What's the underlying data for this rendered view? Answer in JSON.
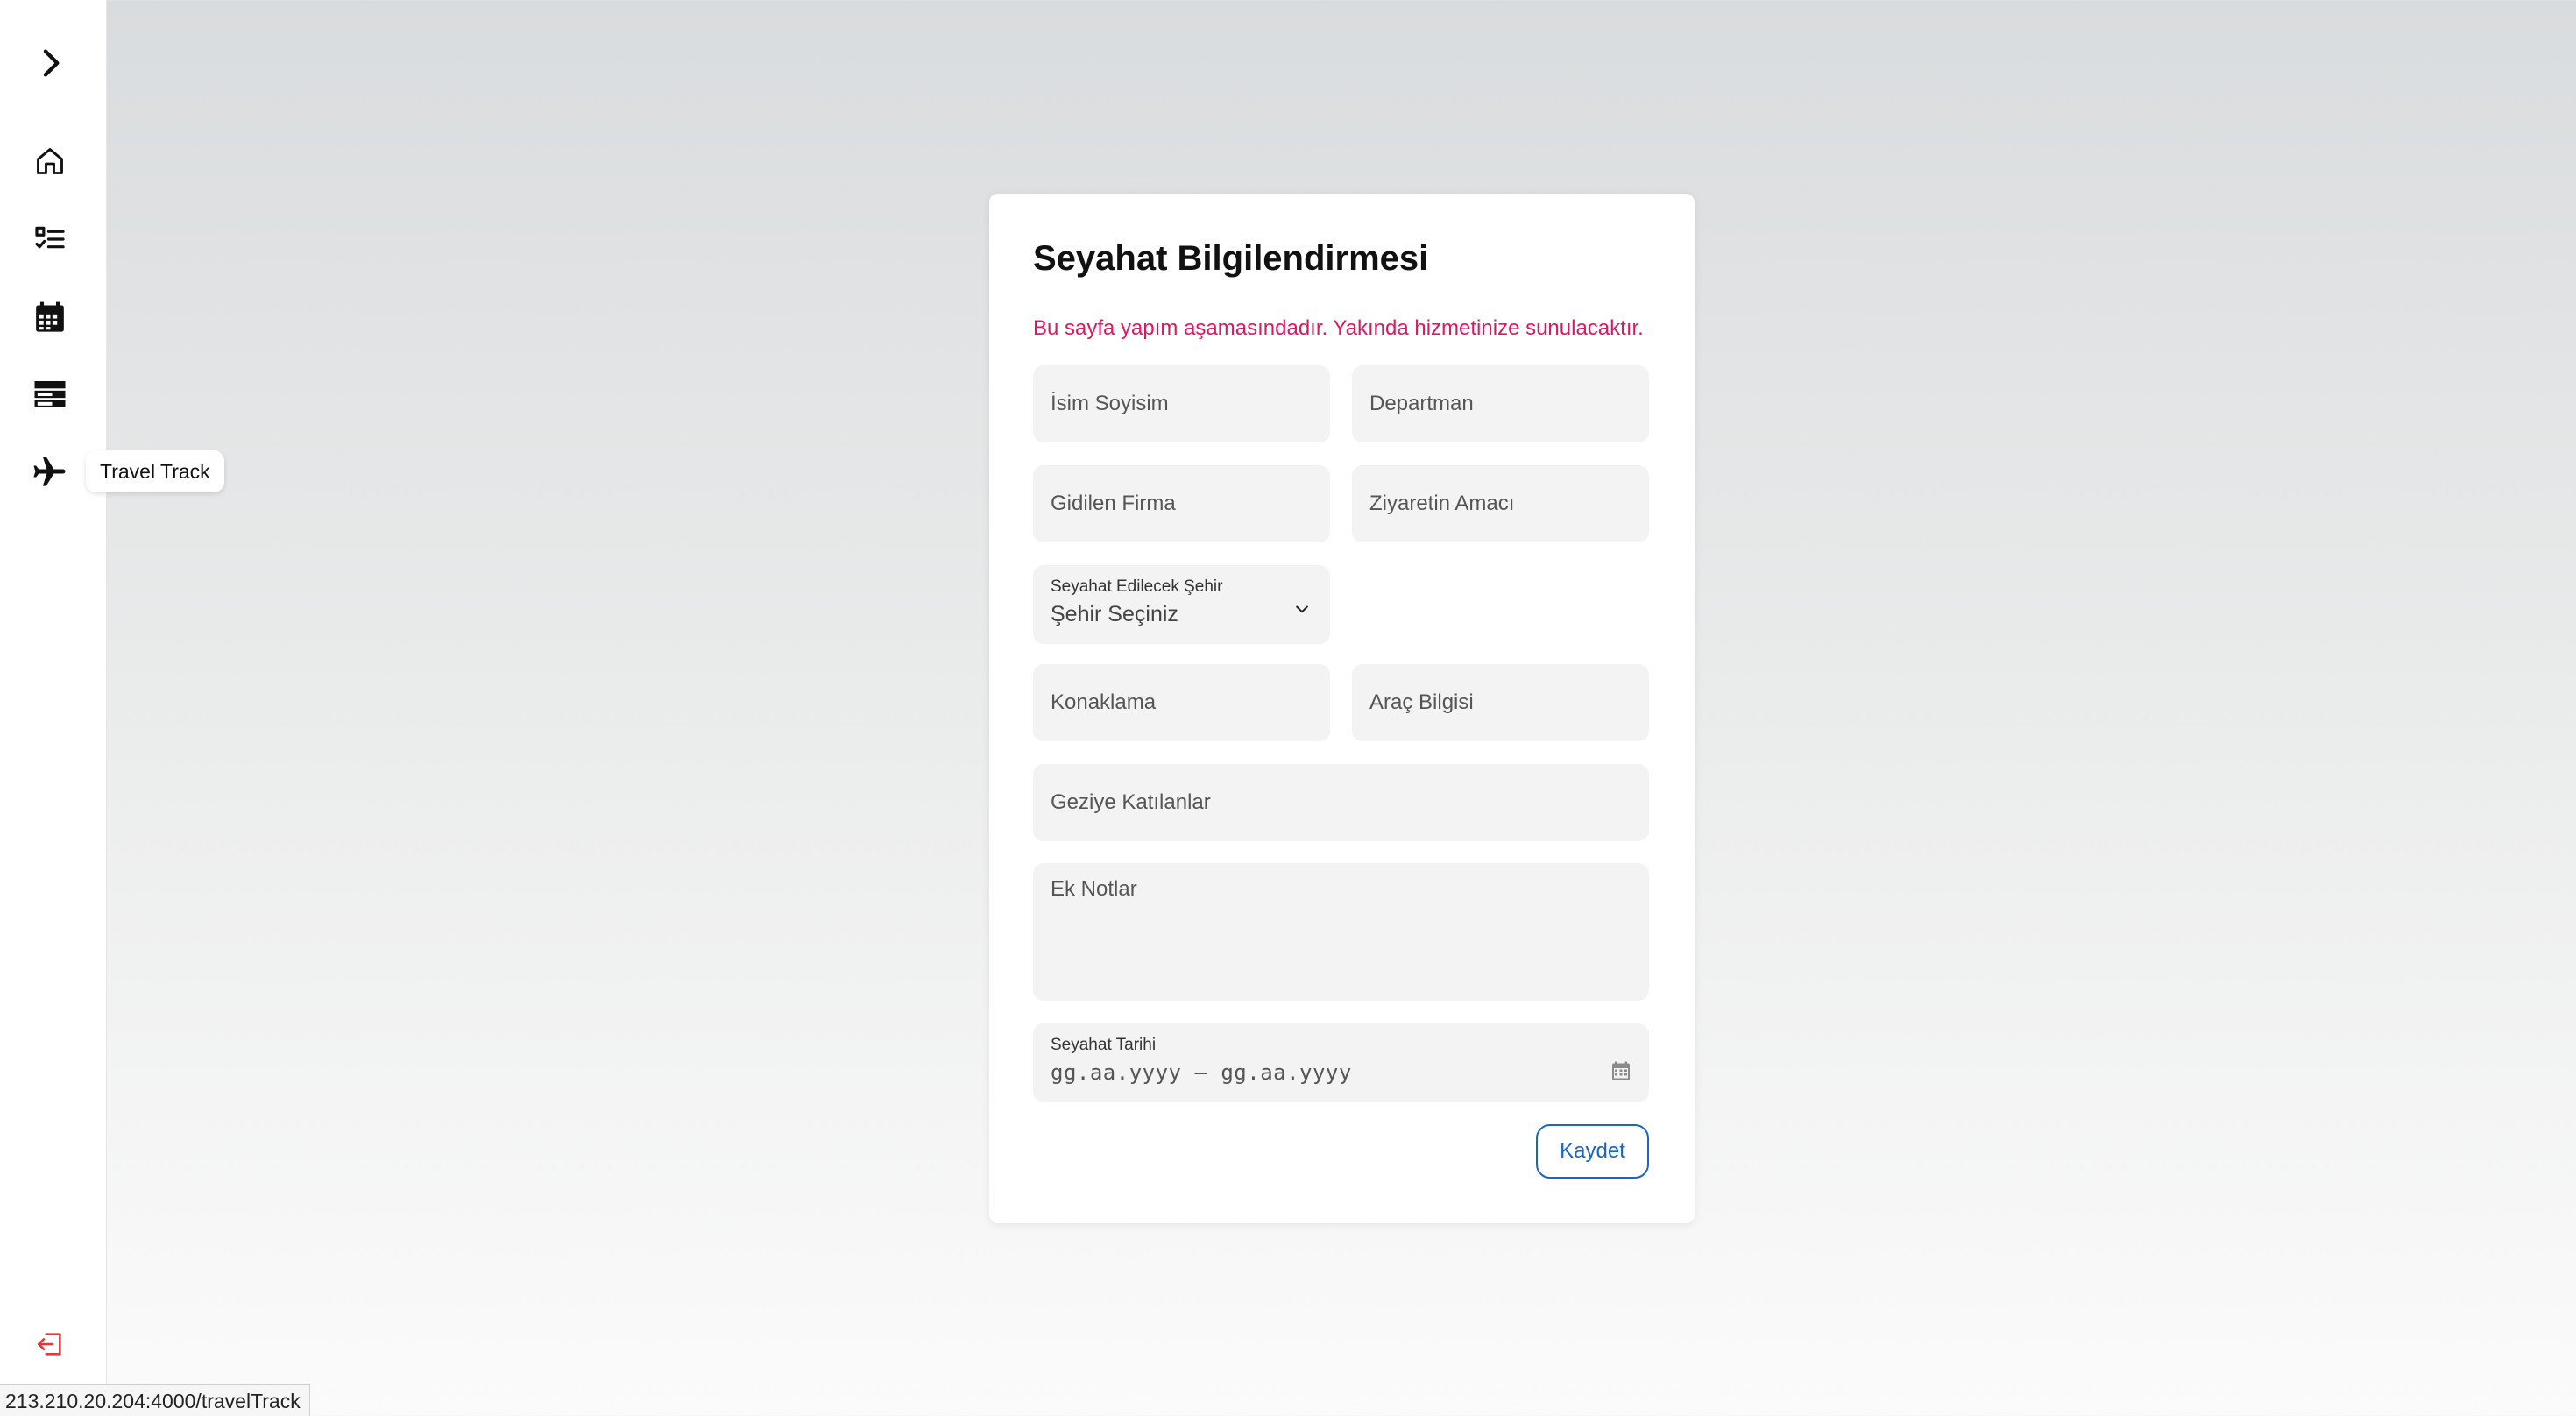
{
  "sidebar": {
    "items": [
      {
        "icon": "chevron-right-icon"
      },
      {
        "icon": "home-icon"
      },
      {
        "icon": "checklist-icon"
      },
      {
        "icon": "calendar-icon"
      },
      {
        "icon": "storage-icon"
      },
      {
        "icon": "airplane-icon",
        "tooltip": "Travel Track"
      }
    ],
    "logout_icon": "logout-icon",
    "logout_color": "#e53935"
  },
  "statusbar": {
    "url": "213.210.20.204:4000/travelTrack"
  },
  "form": {
    "title": "Seyahat Bilgilendirmesi",
    "warning": "Bu sayfa yapım aşamasındadır. Yakında hizmetinize sunulacaktır.",
    "warning_color": "#d81b60",
    "name_placeholder": "İsim Soyisim",
    "department_placeholder": "Departman",
    "company_placeholder": "Gidilen Firma",
    "purpose_placeholder": "Ziyaretin Amacı",
    "city": {
      "label": "Seyahat Edilecek Şehir",
      "selected": "Şehir Seçiniz"
    },
    "accommodation_placeholder": "Konaklama",
    "vehicle_placeholder": "Araç Bilgisi",
    "participants_placeholder": "Geziye Katılanlar",
    "notes_placeholder": "Ek Notlar",
    "date": {
      "label": "Seyahat Tarihi",
      "value": "gg.aa.yyyy – gg.aa.yyyy"
    },
    "save_label": "Kaydet",
    "accent_color": "#1d64c8"
  }
}
